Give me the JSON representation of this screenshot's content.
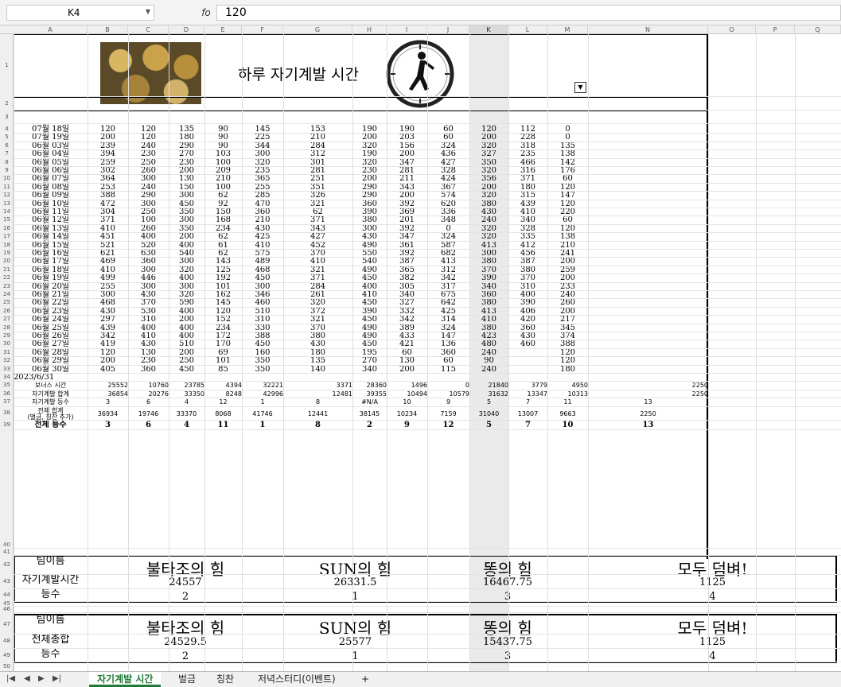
{
  "formula_bar": {
    "cell_ref": "K4",
    "fx_label": "fo",
    "value": "120"
  },
  "columns": [
    "A",
    "B",
    "C",
    "D",
    "E",
    "F",
    "G",
    "H",
    "I",
    "J",
    "K",
    "L",
    "M",
    "N",
    "O",
    "P",
    "Q"
  ],
  "selected_column": "K",
  "sheet": {
    "title": "하루 자기계발 시간",
    "rows": [
      {
        "n": "4",
        "d": "07월 18일",
        "v": [
          "120",
          "120",
          "135",
          "90",
          "145",
          "153",
          "190",
          "190",
          "60",
          "120",
          "112",
          "0"
        ]
      },
      {
        "n": "5",
        "d": "07월 19일",
        "v": [
          "200",
          "120",
          "180",
          "90",
          "225",
          "210",
          "200",
          "203",
          "60",
          "200",
          "228",
          "0"
        ]
      },
      {
        "n": "6",
        "d": "06월 03일",
        "v": [
          "239",
          "240",
          "290",
          "90",
          "344",
          "284",
          "320",
          "156",
          "324",
          "320",
          "318",
          "135"
        ]
      },
      {
        "n": "7",
        "d": "06월 04일",
        "v": [
          "394",
          "230",
          "270",
          "103",
          "300",
          "312",
          "190",
          "200",
          "436",
          "327",
          "235",
          "138"
        ]
      },
      {
        "n": "8",
        "d": "06월 05일",
        "v": [
          "259",
          "250",
          "230",
          "100",
          "320",
          "301",
          "320",
          "347",
          "427",
          "350",
          "466",
          "142"
        ]
      },
      {
        "n": "9",
        "d": "06월 06일",
        "v": [
          "302",
          "260",
          "200",
          "209",
          "235",
          "281",
          "230",
          "281",
          "328",
          "320",
          "316",
          "176"
        ]
      },
      {
        "n": "10",
        "d": "06월 07일",
        "v": [
          "364",
          "300",
          "130",
          "210",
          "365",
          "251",
          "200",
          "211",
          "424",
          "356",
          "371",
          "60"
        ]
      },
      {
        "n": "11",
        "d": "06월 08일",
        "v": [
          "253",
          "240",
          "150",
          "100",
          "255",
          "351",
          "290",
          "343",
          "367",
          "200",
          "180",
          "120"
        ]
      },
      {
        "n": "12",
        "d": "06월 09일",
        "v": [
          "388",
          "290",
          "300",
          "62",
          "285",
          "326",
          "290",
          "200",
          "574",
          "320",
          "315",
          "147"
        ]
      },
      {
        "n": "13",
        "d": "06월 10일",
        "v": [
          "472",
          "300",
          "450",
          "92",
          "470",
          "321",
          "360",
          "392",
          "620",
          "380",
          "439",
          "120"
        ]
      },
      {
        "n": "14",
        "d": "06월 11일",
        "v": [
          "304",
          "250",
          "350",
          "150",
          "360",
          "62",
          "390",
          "369",
          "336",
          "430",
          "410",
          "220"
        ]
      },
      {
        "n": "15",
        "d": "06월 12일",
        "v": [
          "371",
          "100",
          "300",
          "168",
          "210",
          "371",
          "380",
          "201",
          "348",
          "240",
          "340",
          "60"
        ]
      },
      {
        "n": "16",
        "d": "06월 13일",
        "v": [
          "410",
          "260",
          "350",
          "234",
          "430",
          "343",
          "300",
          "392",
          "0",
          "320",
          "328",
          "120"
        ]
      },
      {
        "n": "17",
        "d": "06월 14일",
        "v": [
          "451",
          "400",
          "200",
          "62",
          "425",
          "427",
          "430",
          "347",
          "324",
          "320",
          "335",
          "138"
        ]
      },
      {
        "n": "18",
        "d": "06월 15일",
        "v": [
          "521",
          "520",
          "400",
          "61",
          "410",
          "452",
          "490",
          "361",
          "587",
          "413",
          "412",
          "210"
        ]
      },
      {
        "n": "19",
        "d": "06월 16일",
        "v": [
          "621",
          "630",
          "540",
          "62",
          "575",
          "370",
          "550",
          "392",
          "682",
          "300",
          "456",
          "241"
        ]
      },
      {
        "n": "20",
        "d": "06월 17일",
        "v": [
          "469",
          "360",
          "300",
          "143",
          "489",
          "410",
          "540",
          "387",
          "413",
          "380",
          "387",
          "200"
        ]
      },
      {
        "n": "21",
        "d": "06월 18일",
        "v": [
          "410",
          "300",
          "320",
          "125",
          "468",
          "321",
          "490",
          "365",
          "312",
          "370",
          "380",
          "259"
        ]
      },
      {
        "n": "22",
        "d": "06월 19일",
        "v": [
          "499",
          "446",
          "400",
          "192",
          "450",
          "371",
          "450",
          "382",
          "342",
          "390",
          "370",
          "200"
        ]
      },
      {
        "n": "23",
        "d": "06월 20일",
        "v": [
          "255",
          "300",
          "300",
          "101",
          "300",
          "284",
          "400",
          "305",
          "317",
          "340",
          "310",
          "233"
        ]
      },
      {
        "n": "24",
        "d": "06월 21일",
        "v": [
          "300",
          "430",
          "320",
          "162",
          "346",
          "261",
          "410",
          "340",
          "675",
          "360",
          "400",
          "240"
        ]
      },
      {
        "n": "25",
        "d": "06월 22일",
        "v": [
          "468",
          "370",
          "590",
          "145",
          "460",
          "320",
          "450",
          "327",
          "642",
          "380",
          "390",
          "260"
        ]
      },
      {
        "n": "26",
        "d": "06월 23일",
        "v": [
          "430",
          "530",
          "400",
          "120",
          "510",
          "372",
          "390",
          "332",
          "425",
          "413",
          "406",
          "200"
        ]
      },
      {
        "n": "27",
        "d": "06월 24일",
        "v": [
          "297",
          "310",
          "200",
          "152",
          "310",
          "321",
          "450",
          "342",
          "314",
          "410",
          "420",
          "217"
        ]
      },
      {
        "n": "28",
        "d": "06월 25일",
        "v": [
          "439",
          "400",
          "400",
          "234",
          "330",
          "370",
          "490",
          "389",
          "324",
          "380",
          "360",
          "345"
        ]
      },
      {
        "n": "29",
        "d": "06월 26일",
        "v": [
          "342",
          "410",
          "400",
          "172",
          "388",
          "380",
          "490",
          "433",
          "147",
          "423",
          "430",
          "374"
        ]
      },
      {
        "n": "30",
        "d": "06월 27일",
        "v": [
          "419",
          "430",
          "510",
          "170",
          "450",
          "430",
          "450",
          "421",
          "136",
          "480",
          "460",
          "388"
        ]
      },
      {
        "n": "31",
        "d": "06월 28일",
        "v": [
          "120",
          "130",
          "200",
          "69",
          "160",
          "180",
          "195",
          "60",
          "360",
          "240",
          "",
          "120"
        ]
      },
      {
        "n": "32",
        "d": "06월 29일",
        "v": [
          "200",
          "230",
          "250",
          "101",
          "350",
          "135",
          "270",
          "130",
          "60",
          "90",
          "",
          "120"
        ]
      },
      {
        "n": "33",
        "d": "06월 30일",
        "v": [
          "405",
          "360",
          "450",
          "85",
          "350",
          "140",
          "340",
          "200",
          "115",
          "240",
          "",
          "180"
        ]
      }
    ],
    "row34": "2023/6/31",
    "row35": {
      "label": "보너스 시간",
      "v": [
        "25552",
        "10760",
        "23785",
        "4394",
        "32221",
        "",
        "3371",
        "28360",
        "1496",
        "0",
        "21840",
        "3779",
        "4950",
        "2250"
      ]
    },
    "row36": {
      "label": "자기계발 합계",
      "v": [
        "36854",
        "20276",
        "33350",
        "8248",
        "42996",
        "12481",
        "39355",
        "10494",
        "10579",
        "31632",
        "13347",
        "10313",
        "2250"
      ]
    },
    "row37": {
      "label": "자기계발 등수",
      "v": [
        "3",
        "6",
        "4",
        "12",
        "1",
        "8",
        "#N/A",
        "10",
        "9",
        "5",
        "7",
        "11",
        "13"
      ]
    },
    "row38": {
      "label1": "전체 합계",
      "label2": "(벌금, 칭찬 추가)",
      "v": [
        "36934",
        "19746",
        "33370",
        "8068",
        "41746",
        "12441",
        "38145",
        "10234",
        "7159",
        "31040",
        "13007",
        "9663",
        "2250"
      ]
    },
    "row39": {
      "label": "전체 등수",
      "v": [
        "3",
        "6",
        "4",
        "11",
        "1",
        "8",
        "2",
        "9",
        "12",
        "5",
        "7",
        "10",
        "13"
      ]
    },
    "table1": {
      "label_team": "팀이름",
      "label_time": "자기계발시간",
      "label_rank": "등수",
      "teams": [
        {
          "name": "불타조의 힘",
          "value": "24557",
          "rank": "2"
        },
        {
          "name": "SUN의 힘",
          "value": "26331.5",
          "rank": "1"
        },
        {
          "name": "똥의 힘",
          "value": "16467.75",
          "rank": "3"
        },
        {
          "name": "모두 덤벼!",
          "value": "1125",
          "rank": "4"
        }
      ]
    },
    "table2": {
      "label_team": "팀이름",
      "label_time": "전체총합",
      "label_rank": "등수",
      "teams": [
        {
          "name": "불타조의 힘",
          "value": "24529.5",
          "rank": "2"
        },
        {
          "name": "SUN의 힘",
          "value": "25577",
          "rank": "1"
        },
        {
          "name": "똥의 힘",
          "value": "15437.75",
          "rank": "3"
        },
        {
          "name": "모두 덤벼!",
          "value": "1125",
          "rank": "4"
        }
      ]
    }
  },
  "tabs": [
    "자기계발 시간",
    "벌금",
    "칭찬",
    "저녁스터디(이벤트)"
  ],
  "active_tab": "자기계발 시간",
  "add_tab": "+"
}
